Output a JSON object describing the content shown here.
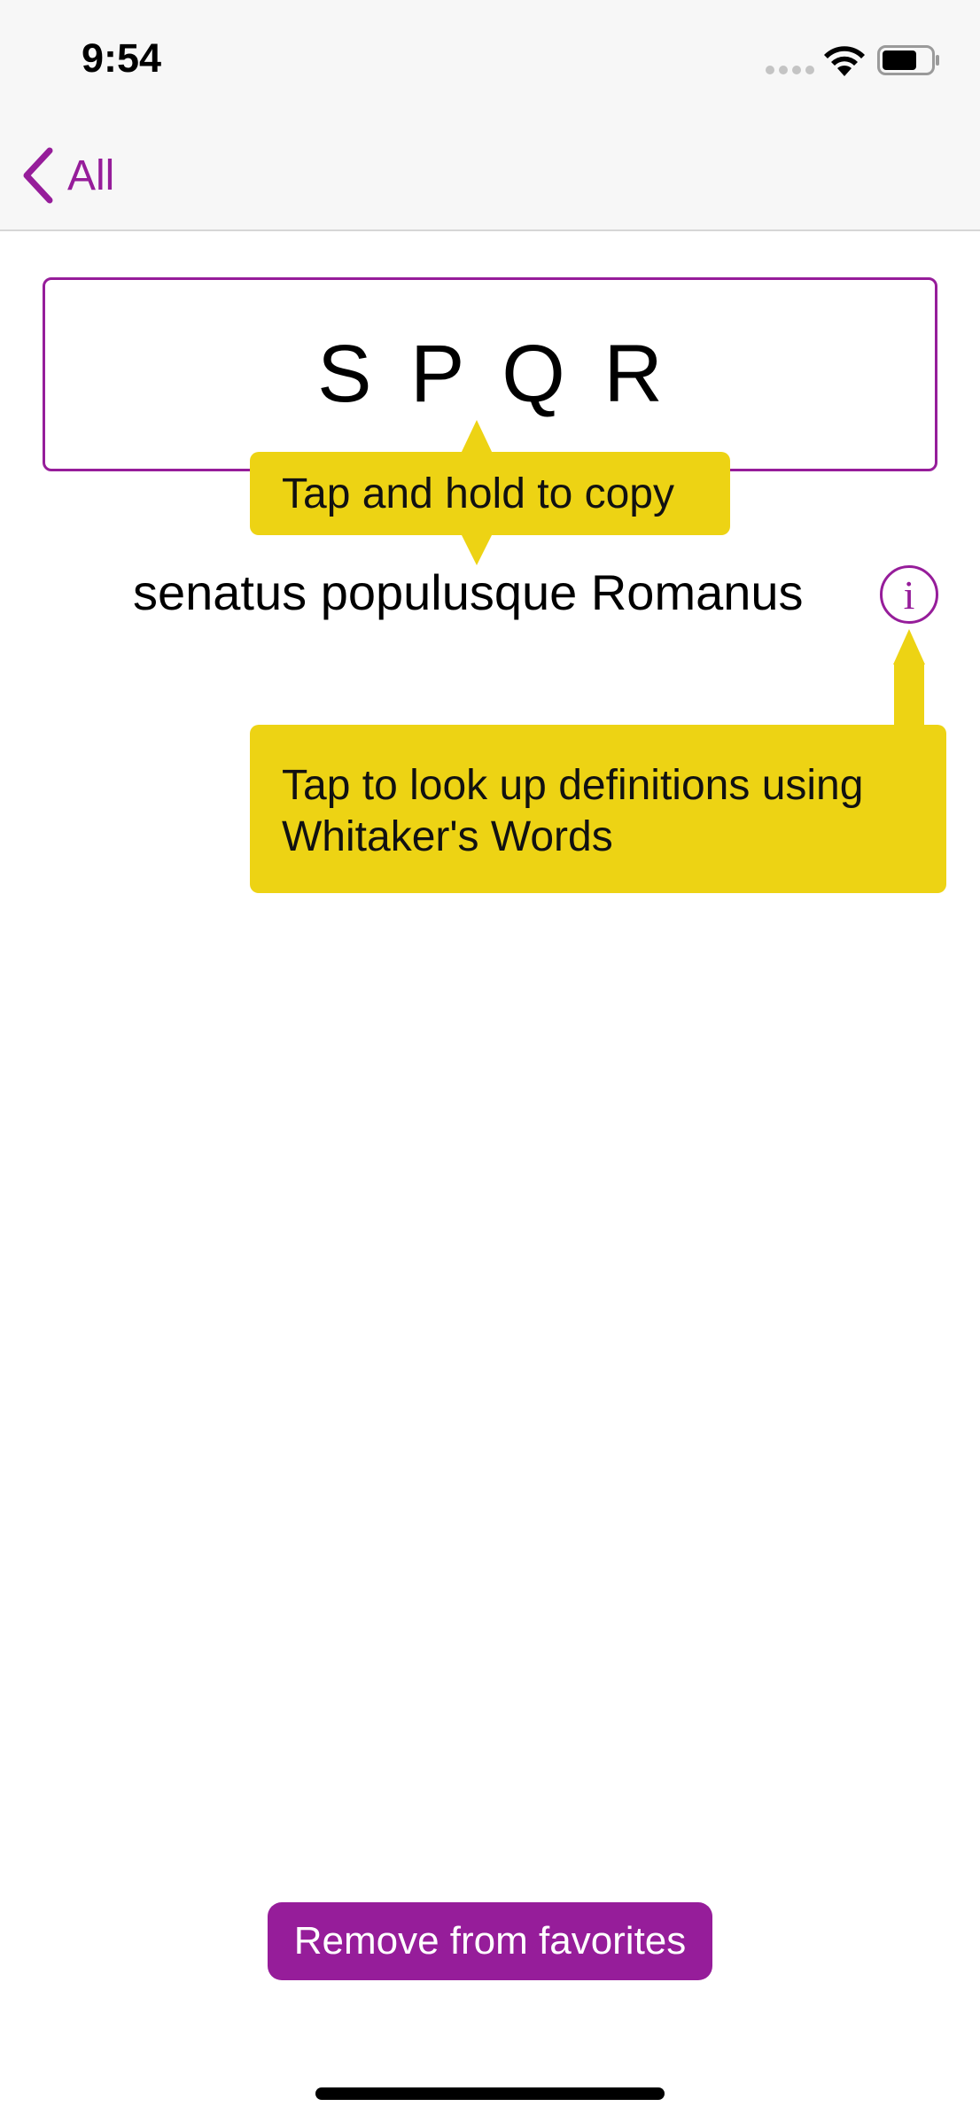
{
  "status_bar": {
    "time": "9:54",
    "icons": [
      "signal-dots-icon",
      "wifi-icon",
      "battery-icon"
    ]
  },
  "nav": {
    "back_label": "All",
    "back_icon": "chevron-left-icon"
  },
  "entry": {
    "abbreviation": "S P Q R",
    "expansion": "senatus populusque Romanus",
    "info_icon": "info-icon",
    "info_glyph": "i"
  },
  "tooltips": {
    "copy_hint": "Tap and hold to copy",
    "lookup_hint_line1": "Tap to look up definitions using",
    "lookup_hint_line2": "Whitaker's Words"
  },
  "actions": {
    "remove_favorite_label": "Remove from favorites"
  },
  "colors": {
    "accent": "#961d9a",
    "tooltip": "#edd314",
    "bar_background": "#f7f7f7"
  }
}
